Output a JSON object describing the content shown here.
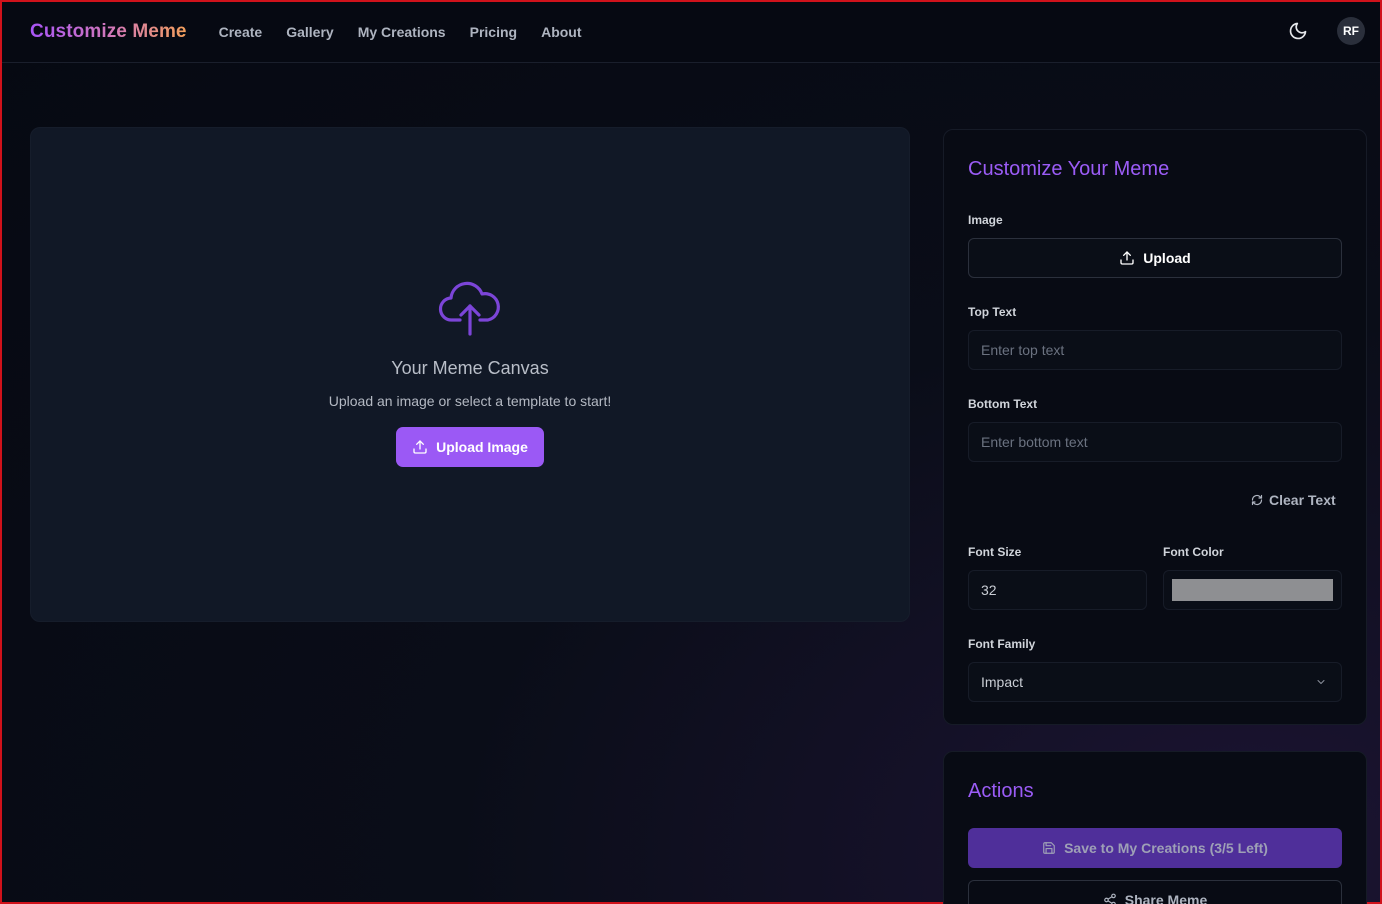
{
  "brand": "Customize Meme",
  "nav": [
    "Create",
    "Gallery",
    "My Creations",
    "Pricing",
    "About"
  ],
  "user_initials": "RF",
  "canvas": {
    "title": "Your Meme Canvas",
    "subtitle": "Upload an image or select a template to start!",
    "upload_button": "Upload Image"
  },
  "customize": {
    "heading": "Customize Your Meme",
    "image_label": "Image",
    "upload_label": "Upload",
    "top_text_label": "Top Text",
    "top_text_placeholder": "Enter top text",
    "bottom_text_label": "Bottom Text",
    "bottom_text_placeholder": "Enter bottom text",
    "clear_text": "Clear Text",
    "font_size_label": "Font Size",
    "font_size_value": "32",
    "font_color_label": "Font Color",
    "font_color_value": "#8e8f92",
    "font_family_label": "Font Family",
    "font_family_value": "Impact"
  },
  "actions": {
    "heading": "Actions",
    "save_label": "Save to My Creations (3/5 Left)",
    "share_label": "Share Meme"
  },
  "colors": {
    "accent": "#9b59f5",
    "background": "#060912",
    "card": "#111826"
  }
}
